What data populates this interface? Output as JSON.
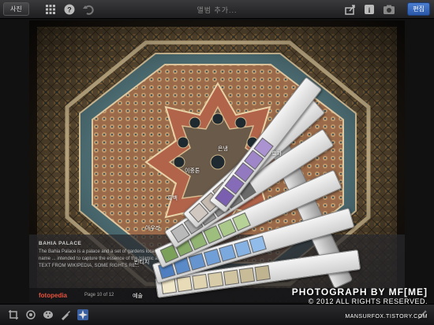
{
  "toolbar": {
    "photos_label": "사진",
    "title": "앨범 추가...",
    "edit_label": "편집",
    "icons": [
      "grid-icon",
      "help-icon",
      "undo-icon",
      "share-icon",
      "info-icon",
      "camera-icon"
    ]
  },
  "caption": {
    "title": "BAHIA PALACE",
    "body": "The Bahia Palace is a palace and a set of gardens located ... intended to be the greatest palace of its time. The name ... intended to capture the essence of the Islamic and Moroccan style.",
    "source": "TEXT FROM WIKIPEDIA, SOME RIGHTS RE...",
    "logo": "fotopedia",
    "page": "Page 10 of 12"
  },
  "filter_fan": {
    "labels": [
      "흑백",
      "이중톤",
      "은냉",
      "아우라",
      "빈티지",
      "예술",
      "효과"
    ],
    "colors": [
      "#7a5fb0",
      "#d0c8c0",
      "#b9b9b9",
      "#7aa05a",
      "#4f7fc0",
      "#e0d090"
    ]
  },
  "bottombar": {
    "icons": [
      "crop-icon",
      "rotate-icon",
      "color-icon",
      "brush-icon",
      "effects-icon",
      "magic-icon"
    ]
  },
  "watermark": {
    "line1": "PHOTOGRAPH BY MF[ME]",
    "line2": "© 2012 ALL RIGHTS RESERVED.",
    "line3": "MANSURFOX.TISTORY.COM"
  }
}
